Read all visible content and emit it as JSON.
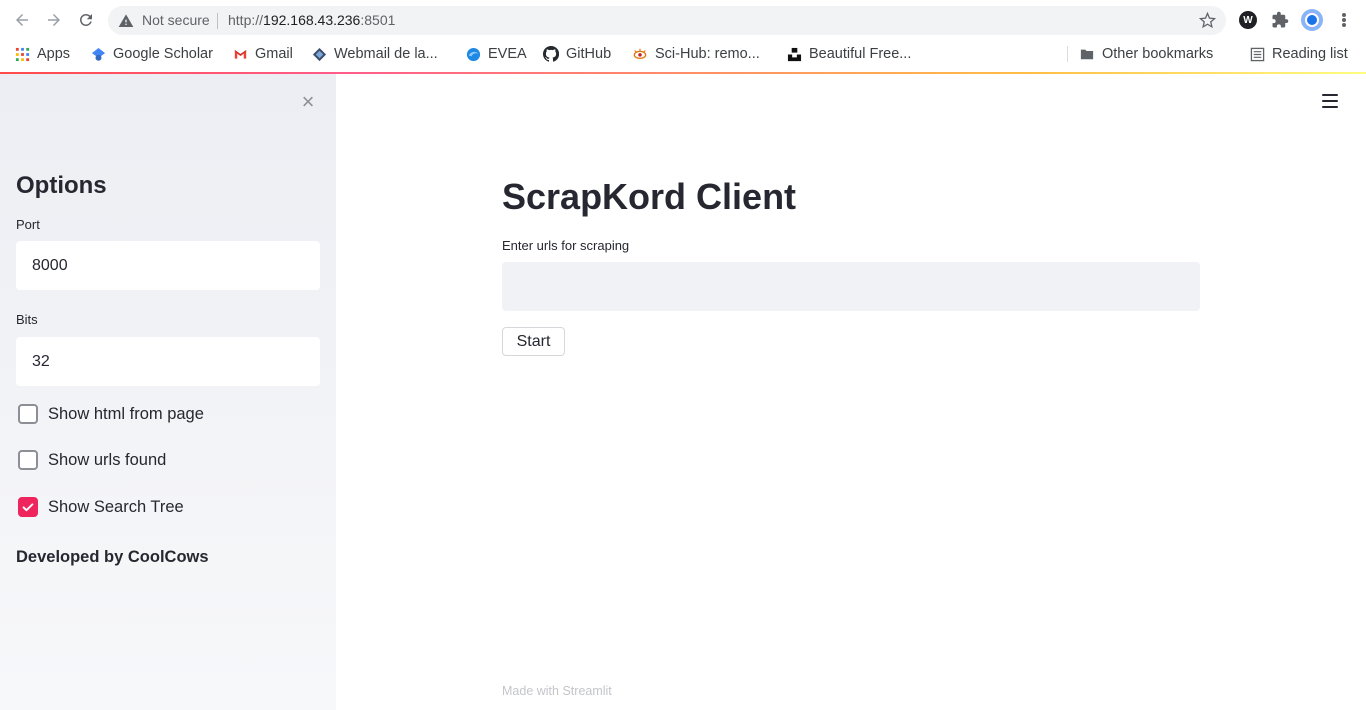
{
  "browser": {
    "security_label": "Not secure",
    "url_prefix": "http://",
    "url_host": "192.168.43.236",
    "url_port": ":8501",
    "bookmarks": [
      {
        "label": "Apps",
        "icon": "apps-grid-icon"
      },
      {
        "label": "Google Scholar",
        "icon": "scholar-icon"
      },
      {
        "label": "Gmail",
        "icon": "gmail-icon"
      },
      {
        "label": "Webmail de la...",
        "icon": "webmail-icon"
      },
      {
        "label": "EVEA",
        "icon": "evea-icon"
      },
      {
        "label": "GitHub",
        "icon": "github-icon"
      },
      {
        "label": "Sci-Hub: remo...",
        "icon": "scihub-icon"
      },
      {
        "label": "Beautiful Free...",
        "icon": "unsplash-icon"
      }
    ],
    "other_bookmarks": "Other bookmarks",
    "reading_list": "Reading list"
  },
  "sidebar": {
    "title": "Options",
    "port_label": "Port",
    "port_value": "8000",
    "bits_label": "Bits",
    "bits_value": "32",
    "checkboxes": [
      {
        "label": "Show html from page",
        "checked": false
      },
      {
        "label": "Show urls found",
        "checked": false
      },
      {
        "label": "Show Search Tree",
        "checked": true
      }
    ],
    "footer": "Developed by CoolCows"
  },
  "main": {
    "title": "ScrapKord Client",
    "urls_label": "Enter urls for scraping",
    "urls_value": "",
    "start_label": "Start",
    "footer_prefix": "Made with",
    "footer_brand": "Streamlit"
  },
  "colors": {
    "accent": "#f0245d",
    "sidebar_bg": "#f0f2f6",
    "text": "#262730"
  }
}
